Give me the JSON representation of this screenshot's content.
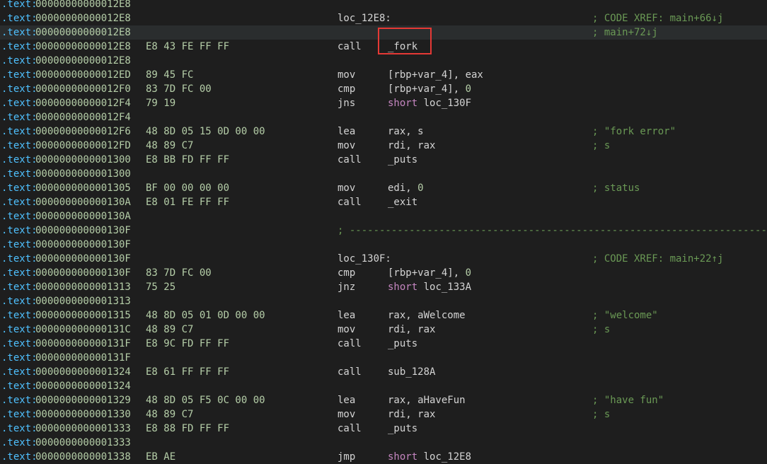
{
  "listing": [
    {
      "seg": ".text:",
      "addr": "00000000000012E8",
      "bytes": "",
      "label": "",
      "mnem": "",
      "ops": [],
      "comment": ""
    },
    {
      "seg": ".text:",
      "addr": "00000000000012E8",
      "bytes": "",
      "label": "loc_12E8:",
      "mnem": "",
      "ops": [],
      "comment": "; CODE XREF: main+66↓j"
    },
    {
      "seg": ".text:",
      "addr": "00000000000012E8",
      "bytes": "",
      "label": "",
      "mnem": "",
      "ops": [],
      "comment": "; main+72↓j",
      "highlighted": true
    },
    {
      "seg": ".text:",
      "addr": "00000000000012E8",
      "bytes": "E8 43 FE FF FF",
      "label": "",
      "mnem": "call",
      "ops": [
        {
          "t": "_fork",
          "k": "plain"
        }
      ],
      "comment": ""
    },
    {
      "seg": ".text:",
      "addr": "00000000000012E8",
      "bytes": "",
      "label": "",
      "mnem": "",
      "ops": [],
      "comment": ""
    },
    {
      "seg": ".text:",
      "addr": "00000000000012ED",
      "bytes": "89 45 FC",
      "label": "",
      "mnem": "mov",
      "ops": [
        {
          "t": "[rbp+var_4], eax",
          "k": "plain"
        }
      ],
      "comment": ""
    },
    {
      "seg": ".text:",
      "addr": "00000000000012F0",
      "bytes": "83 7D FC 00",
      "label": "",
      "mnem": "cmp",
      "ops": [
        {
          "t": "[rbp+var_4], ",
          "k": "plain"
        },
        {
          "t": "0",
          "k": "num"
        }
      ],
      "comment": ""
    },
    {
      "seg": ".text:",
      "addr": "00000000000012F4",
      "bytes": "79 19",
      "label": "",
      "mnem": "jns",
      "ops": [
        {
          "t": "short",
          "k": "kw"
        },
        {
          "t": " loc_130F",
          "k": "plain"
        }
      ],
      "comment": ""
    },
    {
      "seg": ".text:",
      "addr": "00000000000012F4",
      "bytes": "",
      "label": "",
      "mnem": "",
      "ops": [],
      "comment": ""
    },
    {
      "seg": ".text:",
      "addr": "00000000000012F6",
      "bytes": "48 8D 05 15 0D 00 00",
      "label": "",
      "mnem": "lea",
      "ops": [
        {
          "t": "rax, s",
          "k": "plain"
        }
      ],
      "comment": "; \"fork error\""
    },
    {
      "seg": ".text:",
      "addr": "00000000000012FD",
      "bytes": "48 89 C7",
      "label": "",
      "mnem": "mov",
      "ops": [
        {
          "t": "rdi, rax",
          "k": "plain"
        }
      ],
      "comment": "; s"
    },
    {
      "seg": ".text:",
      "addr": "0000000000001300",
      "bytes": "E8 BB FD FF FF",
      "label": "",
      "mnem": "call",
      "ops": [
        {
          "t": "_puts",
          "k": "plain"
        }
      ],
      "comment": ""
    },
    {
      "seg": ".text:",
      "addr": "0000000000001300",
      "bytes": "",
      "label": "",
      "mnem": "",
      "ops": [],
      "comment": ""
    },
    {
      "seg": ".text:",
      "addr": "0000000000001305",
      "bytes": "BF 00 00 00 00",
      "label": "",
      "mnem": "mov",
      "ops": [
        {
          "t": "edi, ",
          "k": "plain"
        },
        {
          "t": "0",
          "k": "num"
        }
      ],
      "comment": "; status"
    },
    {
      "seg": ".text:",
      "addr": "000000000000130A",
      "bytes": "E8 01 FE FF FF",
      "label": "",
      "mnem": "call",
      "ops": [
        {
          "t": "_exit",
          "k": "plain"
        }
      ],
      "comment": ""
    },
    {
      "seg": ".text:",
      "addr": "000000000000130A",
      "bytes": "",
      "label": "",
      "mnem": "",
      "ops": [],
      "comment": ""
    },
    {
      "seg": ".text:",
      "addr": "000000000000130F",
      "bytes": "",
      "label": "",
      "mnem": "",
      "ops": [],
      "comment": "",
      "separator": "; ---------------------------------------------------------------------------"
    },
    {
      "seg": ".text:",
      "addr": "000000000000130F",
      "bytes": "",
      "label": "",
      "mnem": "",
      "ops": [],
      "comment": ""
    },
    {
      "seg": ".text:",
      "addr": "000000000000130F",
      "bytes": "",
      "label": "loc_130F:",
      "mnem": "",
      "ops": [],
      "comment": "; CODE XREF: main+22↑j"
    },
    {
      "seg": ".text:",
      "addr": "000000000000130F",
      "bytes": "83 7D FC 00",
      "label": "",
      "mnem": "cmp",
      "ops": [
        {
          "t": "[rbp+var_4], ",
          "k": "plain"
        },
        {
          "t": "0",
          "k": "num"
        }
      ],
      "comment": ""
    },
    {
      "seg": ".text:",
      "addr": "0000000000001313",
      "bytes": "75 25",
      "label": "",
      "mnem": "jnz",
      "ops": [
        {
          "t": "short",
          "k": "kw"
        },
        {
          "t": " loc_133A",
          "k": "plain"
        }
      ],
      "comment": ""
    },
    {
      "seg": ".text:",
      "addr": "0000000000001313",
      "bytes": "",
      "label": "",
      "mnem": "",
      "ops": [],
      "comment": ""
    },
    {
      "seg": ".text:",
      "addr": "0000000000001315",
      "bytes": "48 8D 05 01 0D 00 00",
      "label": "",
      "mnem": "lea",
      "ops": [
        {
          "t": "rax, aWelcome",
          "k": "plain"
        }
      ],
      "comment": "; \"welcome\""
    },
    {
      "seg": ".text:",
      "addr": "000000000000131C",
      "bytes": "48 89 C7",
      "label": "",
      "mnem": "mov",
      "ops": [
        {
          "t": "rdi, rax",
          "k": "plain"
        }
      ],
      "comment": "; s"
    },
    {
      "seg": ".text:",
      "addr": "000000000000131F",
      "bytes": "E8 9C FD FF FF",
      "label": "",
      "mnem": "call",
      "ops": [
        {
          "t": "_puts",
          "k": "plain"
        }
      ],
      "comment": ""
    },
    {
      "seg": ".text:",
      "addr": "000000000000131F",
      "bytes": "",
      "label": "",
      "mnem": "",
      "ops": [],
      "comment": ""
    },
    {
      "seg": ".text:",
      "addr": "0000000000001324",
      "bytes": "E8 61 FF FF FF",
      "label": "",
      "mnem": "call",
      "ops": [
        {
          "t": "sub_128A",
          "k": "plain"
        }
      ],
      "comment": ""
    },
    {
      "seg": ".text:",
      "addr": "0000000000001324",
      "bytes": "",
      "label": "",
      "mnem": "",
      "ops": [],
      "comment": ""
    },
    {
      "seg": ".text:",
      "addr": "0000000000001329",
      "bytes": "48 8D 05 F5 0C 00 00",
      "label": "",
      "mnem": "lea",
      "ops": [
        {
          "t": "rax, aHaveFun",
          "k": "plain"
        }
      ],
      "comment": "; \"have fun\""
    },
    {
      "seg": ".text:",
      "addr": "0000000000001330",
      "bytes": "48 89 C7",
      "label": "",
      "mnem": "mov",
      "ops": [
        {
          "t": "rdi, rax",
          "k": "plain"
        }
      ],
      "comment": "; s"
    },
    {
      "seg": ".text:",
      "addr": "0000000000001333",
      "bytes": "E8 88 FD FF FF",
      "label": "",
      "mnem": "call",
      "ops": [
        {
          "t": "_puts",
          "k": "plain"
        }
      ],
      "comment": ""
    },
    {
      "seg": ".text:",
      "addr": "0000000000001333",
      "bytes": "",
      "label": "",
      "mnem": "",
      "ops": [],
      "comment": ""
    },
    {
      "seg": ".text:",
      "addr": "0000000000001338",
      "bytes": "EB AE",
      "label": "",
      "mnem": "jmp",
      "ops": [
        {
          "t": "short",
          "k": "kw"
        },
        {
          "t": " loc_12E8",
          "k": "plain"
        }
      ],
      "comment": ""
    }
  ],
  "colors": {
    "background": "#1e1e1e",
    "segment": "#4fc1ff",
    "address": "#b5cea8",
    "comment": "#6a9955",
    "keyword": "#c586c0",
    "highlight_box": "#e53935"
  }
}
